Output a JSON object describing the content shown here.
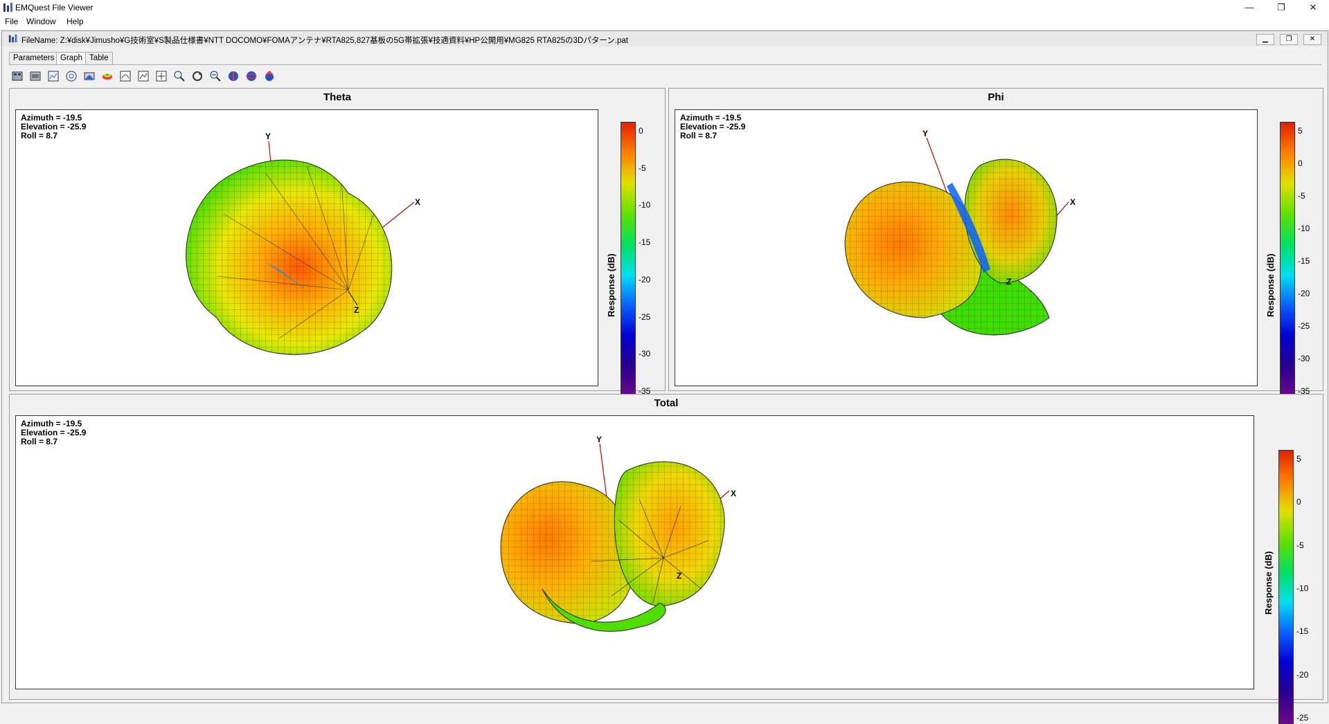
{
  "app": {
    "title": "EMQuest File Viewer"
  },
  "window_controls": {
    "minimize": "—",
    "restore": "❐",
    "close": "✕"
  },
  "menu": [
    "File",
    "Window",
    "Help"
  ],
  "document": {
    "filename_label": "FileName:",
    "filename": "Z:¥disk¥Jimusho¥G技術室¥S製品仕様書¥NTT DOCOMO¥FOMAアンテナ¥RTA825,827基板の5G帯拡張¥技適資料¥HP公開用¥MG825 RTA825の3Dパターン.pat"
  },
  "tabs": [
    {
      "label": "Parameters",
      "active": false
    },
    {
      "label": "Graph",
      "active": true
    },
    {
      "label": "Table",
      "active": false
    }
  ],
  "toolbar_icons": [
    "open-icon",
    "print-icon",
    "chart-icon",
    "polar-icon",
    "data-icon",
    "surface-icon",
    "graph-icon",
    "graph-edit-icon",
    "graph-copy-icon",
    "zoom-icon",
    "rotate-icon",
    "zoom-out-icon",
    "sphere-1-icon",
    "sphere-2-icon",
    "sphere-3-icon"
  ],
  "orientation": {
    "azimuth": "Azimuth = -19.5",
    "elevation": "Elevation = -25.9",
    "roll": "Roll = 8.7"
  },
  "axes": {
    "x": "X",
    "y": "Y",
    "z": "Z"
  },
  "colorbar_label": "Response  (dB)",
  "panels": {
    "theta": {
      "title": "Theta",
      "ticks": [
        "0",
        "-5",
        "-10",
        "-15",
        "-20",
        "-25",
        "-30",
        "-35"
      ]
    },
    "phi": {
      "title": "Phi",
      "ticks": [
        "5",
        "0",
        "-5",
        "-10",
        "-15",
        "-20",
        "-25",
        "-30",
        "-35"
      ]
    },
    "total": {
      "title": "Total",
      "ticks": [
        "5",
        "0",
        "-5",
        "-10",
        "-15",
        "-20",
        "-25"
      ]
    }
  },
  "colors": {
    "scale": [
      "#6a0a8a",
      "#2a0090",
      "#0000d0",
      "#0a60ff",
      "#00e0f0",
      "#00e060",
      "#60e000",
      "#e0e000",
      "#ff8000",
      "#e02000"
    ]
  }
}
